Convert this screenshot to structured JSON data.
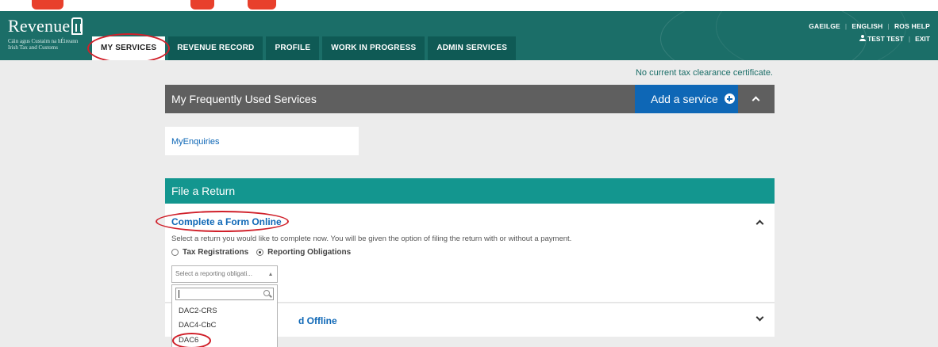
{
  "brand": {
    "name": "Revenue",
    "subtitle_line1": "Cáin agus Custaim na hÉireann",
    "subtitle_line2": "Irish Tax and Customs"
  },
  "nav": {
    "tabs": [
      {
        "label": "MY SERVICES",
        "active": true
      },
      {
        "label": "REVENUE RECORD",
        "active": false
      },
      {
        "label": "PROFILE",
        "active": false
      },
      {
        "label": "WORK IN PROGRESS",
        "active": false
      },
      {
        "label": "ADMIN SERVICES",
        "active": false
      }
    ],
    "top_links": [
      "GAEILGE",
      "ENGLISH",
      "ROS HELP"
    ],
    "user_name": "TEST TEST",
    "exit_label": "EXIT"
  },
  "clearance_notice": "No current tax clearance certificate.",
  "frequent_services": {
    "title": "My Frequently Used Services",
    "add_label": "Add a service",
    "items": [
      "MyEnquiries"
    ]
  },
  "file_return": {
    "title": "File a Return",
    "complete_online": {
      "title": "Complete a Form Online",
      "description": "Select a return you would like to complete now. You will be given the option of filing the return with or without a payment.",
      "options": [
        {
          "label": "Tax Registrations",
          "selected": false
        },
        {
          "label": "Reporting Obligations",
          "selected": true
        }
      ],
      "select_placeholder": "Select a reporting obligati...",
      "search_value": "",
      "menu_options": [
        "DAC2-CRS",
        "DAC4-CbC",
        "DAC6"
      ]
    },
    "offline_fragment": "d Offline"
  },
  "colors": {
    "header": "#1b6e68",
    "tab": "#0f5a55",
    "accent_blue": "#0e67b6",
    "return_head": "#13968f",
    "panel_head": "#5f5f5f",
    "annotation_red": "#d0202a"
  }
}
